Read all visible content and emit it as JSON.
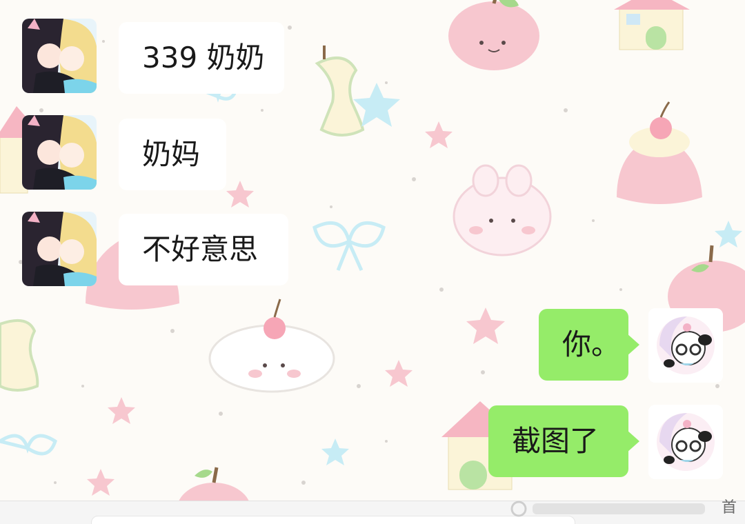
{
  "chat": {
    "messages": [
      {
        "side": "in",
        "text": "339 奶奶"
      },
      {
        "side": "in",
        "text": "奶妈"
      },
      {
        "side": "in",
        "text": "不好意思"
      },
      {
        "side": "out",
        "text": "你。"
      },
      {
        "side": "out",
        "text": "截图了"
      }
    ]
  },
  "bottom": {
    "watermark_char": "首"
  },
  "colors": {
    "incoming_bubble": "#ffffff",
    "outgoing_bubble": "#95ec69",
    "background": "#fdfbf7"
  },
  "icons": {
    "contact_avatar": "anime-couple-avatar",
    "self_avatar": "panda-girl-avatar"
  }
}
